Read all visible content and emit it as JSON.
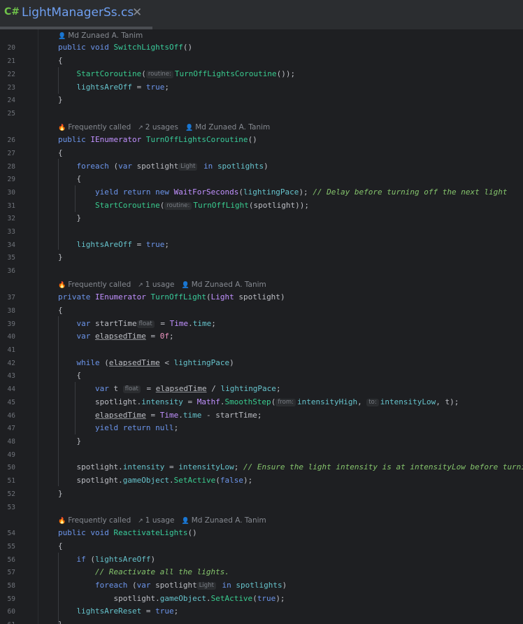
{
  "tab": {
    "lang_icon": "C#",
    "file_name": "LightManagerSs.cs",
    "close_glyph": "✕"
  },
  "lenses": {
    "author": "Md Zunaed A. Tanim",
    "freq": "Frequently called",
    "usages2": "2 usages",
    "usage1": "1 usage"
  },
  "hints": {
    "routine": "routine:",
    "light": "Light",
    "float": "float",
    "from": "from:",
    "to": "to:"
  },
  "lines": {
    "l20": "20",
    "l21": "21",
    "l22": "22",
    "l23": "23",
    "l24": "24",
    "l25": "25",
    "l26": "26",
    "l27": "27",
    "l28": "28",
    "l29": "29",
    "l30": "30",
    "l31": "31",
    "l32": "32",
    "l33": "33",
    "l34": "34",
    "l35": "35",
    "l36": "36",
    "l37": "37",
    "l38": "38",
    "l39": "39",
    "l40": "40",
    "l41": "41",
    "l42": "42",
    "l43": "43",
    "l44": "44",
    "l45": "45",
    "l46": "46",
    "l47": "47",
    "l48": "48",
    "l49": "49",
    "l50": "50",
    "l51": "51",
    "l52": "52",
    "l53": "53",
    "l54": "54",
    "l55": "55",
    "l56": "56",
    "l57": "57",
    "l58": "58",
    "l59": "59",
    "l60": "60",
    "l61": "61"
  },
  "code": {
    "public": "public",
    "private": "private",
    "void": "void",
    "foreach": "foreach",
    "var": "var",
    "in": "in",
    "yield": "yield",
    "return": "return",
    "new": "new",
    "true": "true",
    "false": "false",
    "while": "while",
    "if": "if",
    "null": "null",
    "SwitchLightsOff": "SwitchLightsOff",
    "StartCoroutine": "StartCoroutine",
    "TurnOffLightsCoroutine": "TurnOffLightsCoroutine",
    "lightsAreOff": "lightsAreOff",
    "IEnumerator": "IEnumerator",
    "spotlight": "spotlight",
    "spotlights": "spotlights",
    "WaitForSeconds": "WaitForSeconds",
    "lightingPace": "lightingPace",
    "cmt30": "// Delay before turning off the next light",
    "TurnOffLight": "TurnOffLight",
    "Light": "Light",
    "startTime": "startTime",
    "Time": "Time",
    "time": "time",
    "elapsedTime": "elapsedTime",
    "zero": "0f",
    "t": "t",
    "intensity": "intensity",
    "Mathf": "Mathf",
    "SmoothStep": "SmoothStep",
    "intensityHigh": "intensityHigh",
    "intensityLow": "intensityLow",
    "cmt50": "// Ensure the light intensity is at intensityLow before turning off",
    "gameObject": "gameObject",
    "SetActive": "SetActive",
    "ReactivateLights": "ReactivateLights",
    "cmt57": "// Reactivate all the lights.",
    "lightsAreReset": "lightsAreReset"
  }
}
